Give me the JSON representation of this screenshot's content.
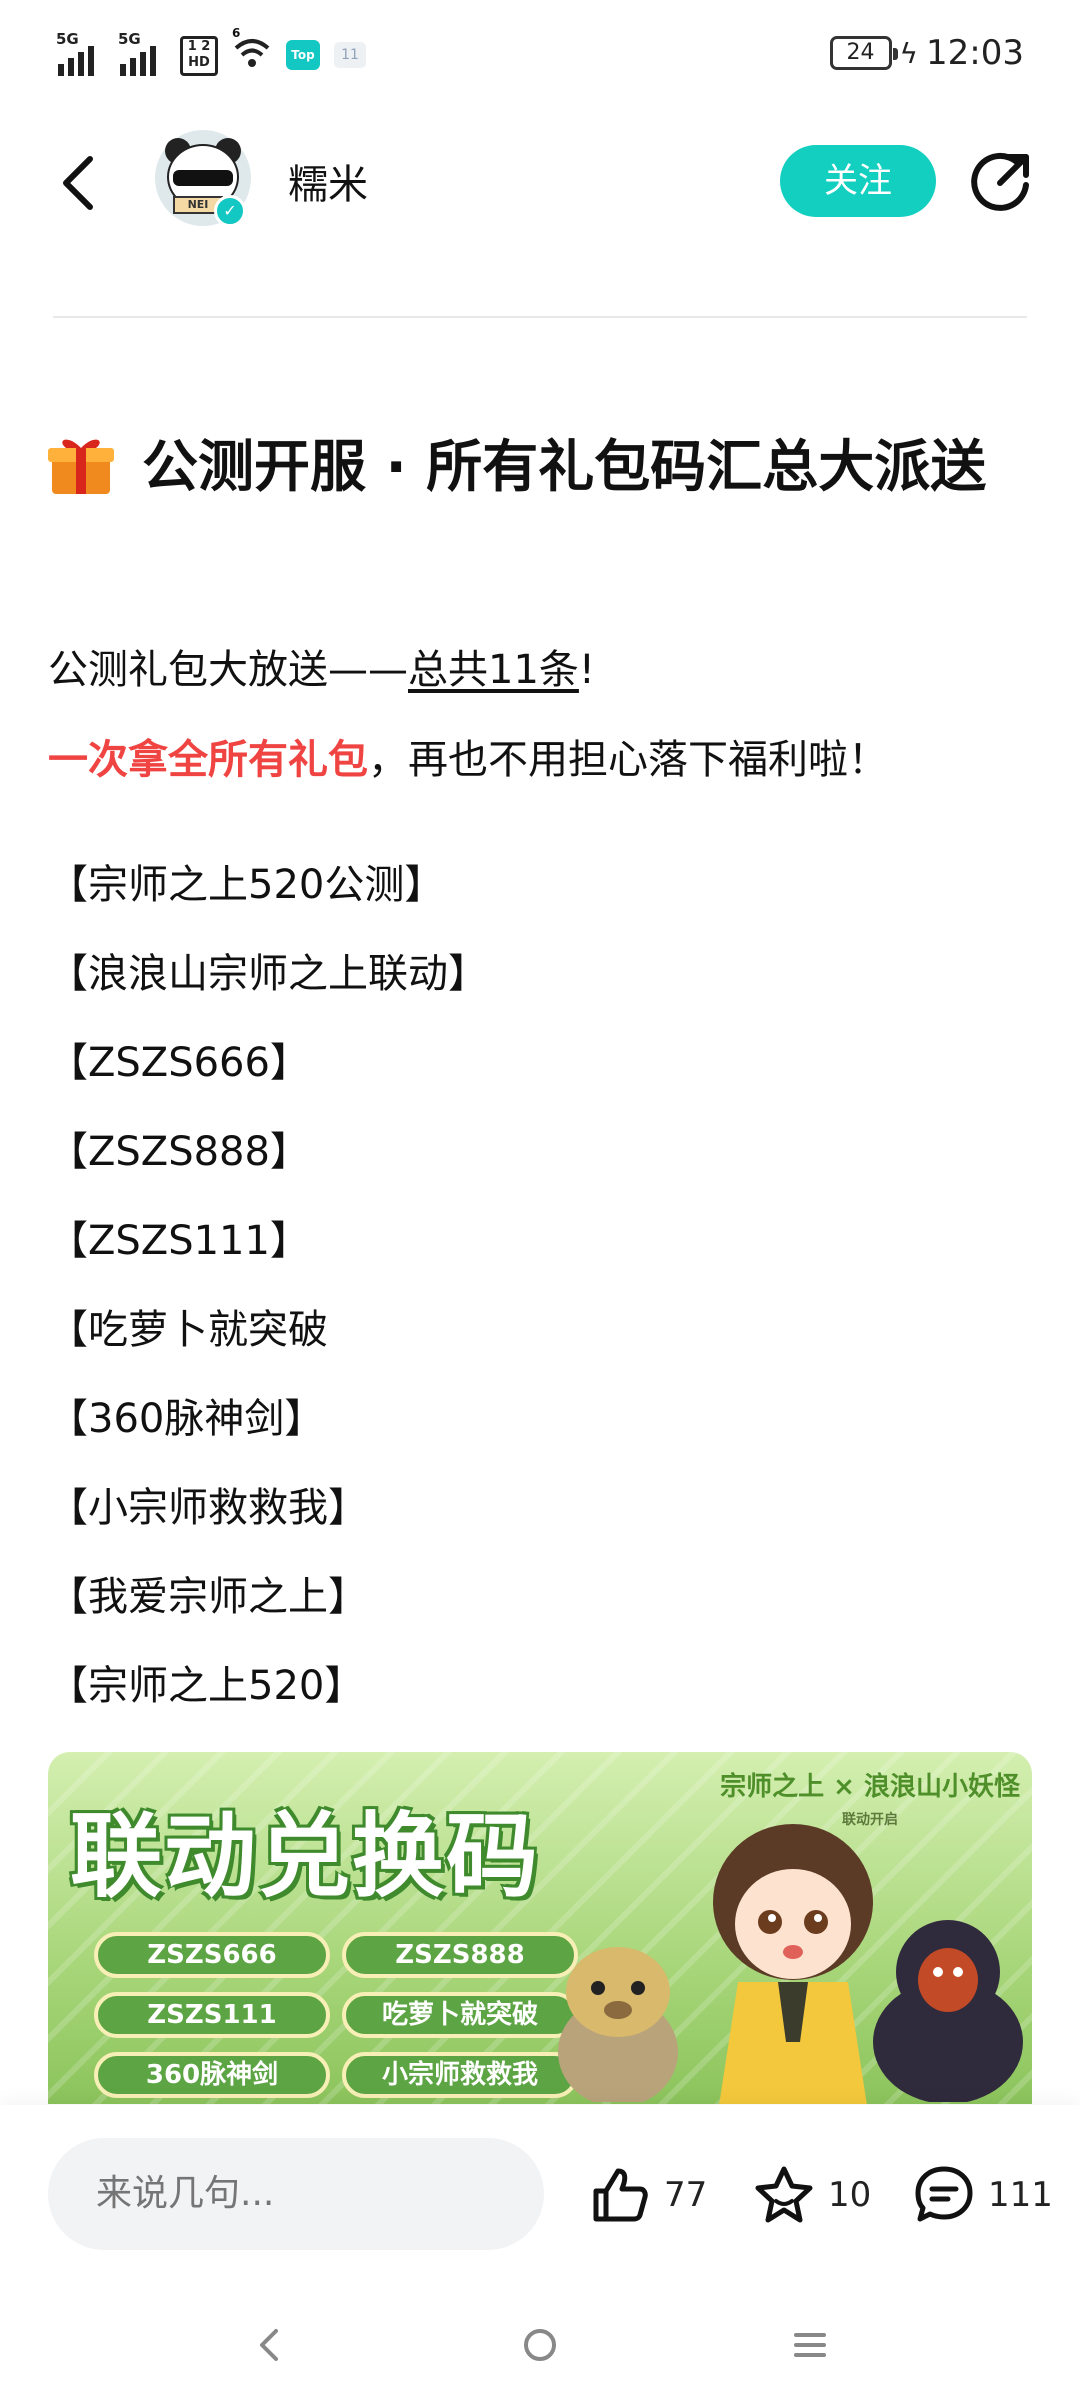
{
  "status_bar": {
    "signal1_label": "5G",
    "signal2_label": "5G",
    "hd_label": "1 2 HD",
    "wifi_label": "6",
    "app_badge": "Top",
    "mini_badge": "11",
    "battery": "24",
    "time": "12:03"
  },
  "header": {
    "author_name": "糯米",
    "follow_label": "关注"
  },
  "post": {
    "title": "公测开服 · 所有礼包码汇总大派送",
    "lead1_prefix": "公测礼包大放送——",
    "lead1_underlined": "总共11条",
    "lead1_suffix": "!",
    "lead2_highlight": "一次拿全所有礼包",
    "lead2_rest": "，再也不用担心落下福利啦！",
    "codes": [
      "【宗师之上520公测】",
      "【浪浪山宗师之上联动】",
      "【ZSZS666】",
      "【ZSZS888】",
      "【ZSZS111】",
      "【吃萝卜就突破",
      "【360脉神剑】",
      "【小宗师救救我】",
      "【我爱宗师之上】",
      "【宗师之上520】"
    ]
  },
  "banner": {
    "title": "联动兑换码",
    "logo_text": "宗师之上 × 浪浪山小妖怪",
    "logo_sub": "联动开启",
    "pills": [
      "ZSZS666",
      "ZSZS888",
      "ZSZS111",
      "吃萝卜就突破",
      "360脉神剑",
      "小宗师救救我"
    ]
  },
  "action_bar": {
    "comment_placeholder": "来说几句...",
    "likes": "77",
    "favorites": "10",
    "comments": "111"
  },
  "colors": {
    "accent": "#13cfc0",
    "highlight_red": "#ef4442",
    "banner_green": "#8cc45c"
  }
}
